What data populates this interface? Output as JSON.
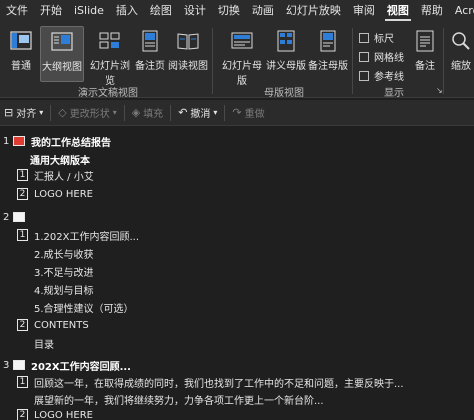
{
  "tabs": [
    {
      "label": "文件"
    },
    {
      "label": "开始"
    },
    {
      "label": "iSlide"
    },
    {
      "label": "插入"
    },
    {
      "label": "绘图"
    },
    {
      "label": "设计"
    },
    {
      "label": "切换"
    },
    {
      "label": "动画"
    },
    {
      "label": "幻灯片放映"
    },
    {
      "label": "审阅"
    },
    {
      "label": "视图"
    },
    {
      "label": "帮助"
    },
    {
      "label": "Acrob"
    }
  ],
  "active_tab": "视图",
  "ribbon": {
    "presentation_views": {
      "label": "演示文稿视图",
      "buttons": [
        {
          "label": "普通",
          "icon": "normal-view-icon"
        },
        {
          "label": "大纲视图",
          "icon": "outline-view-icon",
          "active": true
        },
        {
          "label": "幻灯片浏览",
          "icon": "slide-sorter-icon"
        },
        {
          "label": "备注页",
          "icon": "notes-page-icon"
        },
        {
          "label": "阅读视图",
          "icon": "reading-view-icon"
        }
      ]
    },
    "master_views": {
      "label": "母版视图",
      "buttons": [
        {
          "label": "幻灯片母版",
          "icon": "slide-master-icon"
        },
        {
          "label": "讲义母版",
          "icon": "handout-master-icon"
        },
        {
          "label": "备注母版",
          "icon": "notes-master-icon"
        }
      ]
    },
    "show": {
      "label": "显示",
      "checkboxes": [
        {
          "label": "标尺",
          "checked": false
        },
        {
          "label": "网格线",
          "checked": false
        },
        {
          "label": "参考线",
          "checked": false
        }
      ],
      "launcher": "↘"
    },
    "notes": {
      "label": "备注"
    },
    "zoom": {
      "label": "缩放"
    }
  },
  "quick_toolbar": {
    "align": "对齐",
    "change_shape": "更改形状",
    "fill": "填充",
    "undo": "撤消",
    "redo": "重做"
  },
  "outline": {
    "slides": [
      {
        "number": "1",
        "title": "我的工作总结报告",
        "subtitle": "通用大纲版本",
        "items": [
          {
            "level": "1",
            "text": "汇报人 / 小艾"
          },
          {
            "level": "2",
            "text": "LOGO HERE"
          }
        ]
      },
      {
        "number": "2",
        "title": "",
        "items": [
          {
            "level": "1",
            "text": "1.202X工作内容回顾..."
          },
          {
            "level": "",
            "text": "2.成长与收获"
          },
          {
            "level": "",
            "text": "3.不足与改进"
          },
          {
            "level": "",
            "text": "4.规划与目标"
          },
          {
            "level": "",
            "text": "5.合理性建议（可选）"
          },
          {
            "level": "2",
            "text": "CONTENTS"
          },
          {
            "level": "",
            "text": "目录"
          }
        ]
      },
      {
        "number": "3",
        "title": "202X工作内容回顾...",
        "items": [
          {
            "level": "1",
            "text": "回顾这一年，在取得成绩的同时，我们也找到了工作中的不足和问题，主要反映于..."
          },
          {
            "level": "",
            "text": "展望新的一年，我们将继续努力，力争各项工作更上一个新台阶..."
          },
          {
            "level": "2",
            "text": "LOGO HERE"
          }
        ]
      }
    ]
  }
}
